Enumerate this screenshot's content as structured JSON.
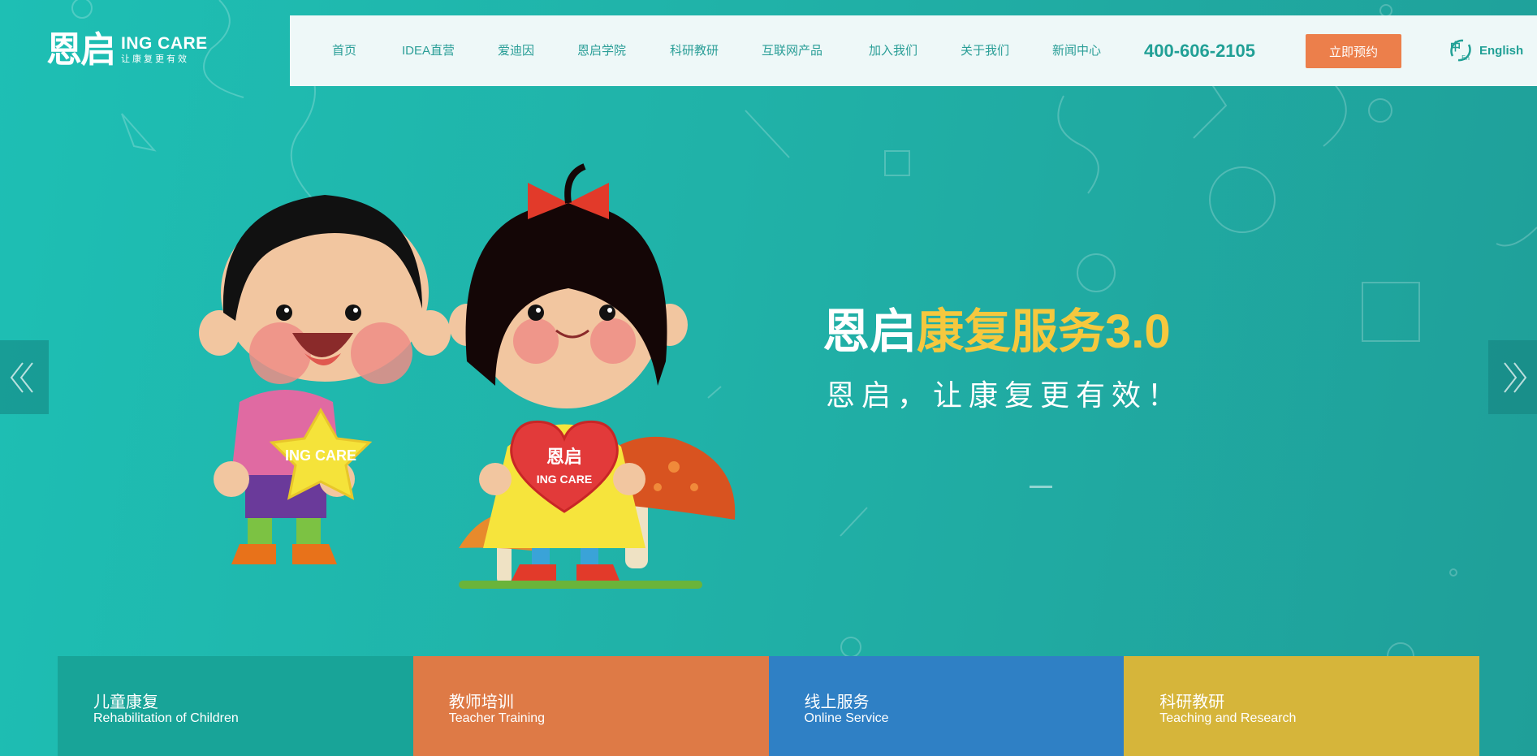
{
  "logo": {
    "mark": "恩启",
    "title": "ING CARE",
    "slogan": "让康复更有效"
  },
  "nav": {
    "items": [
      "首页",
      "IDEA直营",
      "爱迪因",
      "恩启学院",
      "科研教研",
      "互联网产品",
      "加入我们",
      "关于我们",
      "新闻中心"
    ],
    "phone": "400-606-2105",
    "cta_label": "立即预约",
    "lang_label": "English",
    "lang_icon": "zh-en-switch-icon"
  },
  "hero": {
    "title_part1": "恩启",
    "title_part2": "康复服务3.0",
    "subtitle": "恩启，让康复更有效！",
    "badge_star": "ING CARE",
    "badge_heart_mark": "恩启",
    "badge_heart_text": "ING CARE"
  },
  "carousel": {
    "prev_icon": "double-chevron-left-icon",
    "next_icon": "double-chevron-right-icon"
  },
  "cards": [
    {
      "title": "儿童康复",
      "subtitle": "Rehabilitation of Children",
      "color": "#18a498"
    },
    {
      "title": "教师培训",
      "subtitle": "Teacher Training",
      "color": "#de7a46"
    },
    {
      "title": "线上服务",
      "subtitle": "Online Service",
      "color": "#2f80c5"
    },
    {
      "title": "科研教研",
      "subtitle": "Teaching and Research",
      "color": "#d6b53a"
    }
  ],
  "colors": {
    "accent": "#21a096",
    "cta": "#ec7f4b",
    "title_yellow": "#f5c83e"
  }
}
